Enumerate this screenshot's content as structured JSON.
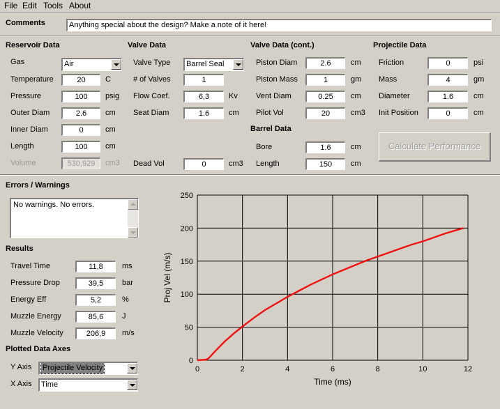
{
  "menu": [
    "File",
    "Edit",
    "Tools",
    "About"
  ],
  "comments": {
    "label": "Comments",
    "value": "Anything special about the design?  Make a note of it here!"
  },
  "reservoir": {
    "title": "Reservoir Data",
    "gas": {
      "label": "Gas",
      "value": "Air"
    },
    "temperature": {
      "label": "Temperature",
      "value": "20",
      "unit": "C"
    },
    "pressure": {
      "label": "Pressure",
      "value": "100",
      "unit": "psig"
    },
    "outer_diam": {
      "label": "Outer Diam",
      "value": "2.6",
      "unit": "cm"
    },
    "inner_diam": {
      "label": "Inner Diam",
      "value": "0",
      "unit": "cm"
    },
    "length": {
      "label": "Length",
      "value": "100",
      "unit": "cm"
    },
    "volume": {
      "label": "Volume",
      "value": "530,929",
      "unit": "cm3"
    }
  },
  "valve": {
    "title": "Valve Data",
    "type": {
      "label": "Valve Type",
      "value": "Barrel Seal"
    },
    "num_valves": {
      "label": "# of Valves",
      "value": "1"
    },
    "flow_coef": {
      "label": "Flow Coef.",
      "value": "6,3",
      "unit": "Kv"
    },
    "seat_diam": {
      "label": "Seat Diam",
      "value": "1.6",
      "unit": "cm"
    },
    "dead_vol": {
      "label": "Dead Vol",
      "value": "0",
      "unit": "cm3"
    }
  },
  "valve_cont": {
    "title": "Valve Data (cont.)",
    "piston_diam": {
      "label": "Piston Diam",
      "value": "2.6",
      "unit": "cm"
    },
    "piston_mass": {
      "label": "Piston Mass",
      "value": "1",
      "unit": "gm"
    },
    "vent_diam": {
      "label": "Vent Diam",
      "value": "0.25",
      "unit": "cm"
    },
    "pilot_vol": {
      "label": "Pilot Vol",
      "value": "20",
      "unit": "cm3"
    }
  },
  "barrel": {
    "title": "Barrel Data",
    "bore": {
      "label": "Bore",
      "value": "1.6",
      "unit": "cm"
    },
    "length": {
      "label": "Length",
      "value": "150",
      "unit": "cm"
    }
  },
  "projectile": {
    "title": "Projectile Data",
    "friction": {
      "label": "Friction",
      "value": "0",
      "unit": "psi"
    },
    "mass": {
      "label": "Mass",
      "value": "4",
      "unit": "gm"
    },
    "diameter": {
      "label": "Diameter",
      "value": "1.6",
      "unit": "cm"
    },
    "init_position": {
      "label": "Init Position",
      "value": "0",
      "unit": "cm"
    }
  },
  "calculate_label": "Calculate Performance",
  "errors": {
    "title": "Errors / Warnings",
    "text": "No warnings.  No errors."
  },
  "results": {
    "title": "Results",
    "travel_time": {
      "label": "Travel Time",
      "value": "11,8",
      "unit": "ms"
    },
    "pressure_drop": {
      "label": "Pressure Drop",
      "value": "39,5",
      "unit": "bar"
    },
    "energy_eff": {
      "label": "Energy Eff",
      "value": "5,2",
      "unit": "%"
    },
    "muzzle_energy": {
      "label": "Muzzle Energy",
      "value": "85,6",
      "unit": "J"
    },
    "muzzle_velocity": {
      "label": "Muzzle Velocity",
      "value": "206,9",
      "unit": "m/s"
    }
  },
  "axes": {
    "title": "Plotted Data Axes",
    "y": {
      "label": "Y Axis",
      "value": "Projectile Velocity"
    },
    "x": {
      "label": "X Axis",
      "value": "Time"
    }
  },
  "colors": {
    "curve": "#ee1111",
    "background": "#d4d0c8"
  },
  "chart_data": {
    "type": "line",
    "xlabel": "Time (ms)",
    "ylabel": "Proj Vel (m/s)",
    "xlim": [
      0,
      12
    ],
    "ylim": [
      0,
      250
    ],
    "xticks": [
      0,
      2,
      4,
      6,
      8,
      10,
      12
    ],
    "yticks": [
      0,
      50,
      100,
      150,
      200,
      250
    ],
    "grid": true,
    "series": [
      {
        "x": [
          0,
          0.4,
          0.5,
          0.8,
          1.2,
          1.6,
          2.0,
          2.5,
          3.0,
          3.5,
          4.0,
          4.5,
          5.0,
          5.5,
          6.0,
          6.5,
          7.0,
          7.5,
          8.0,
          8.5,
          9.0,
          9.5,
          10.0,
          10.5,
          11.0,
          11.5,
          11.8
        ],
        "y": [
          0,
          1,
          3,
          14,
          28,
          40,
          51,
          64,
          76,
          86,
          96,
          105,
          114,
          122,
          130,
          137,
          144,
          151,
          157,
          163,
          169,
          175,
          180,
          186,
          192,
          197,
          200
        ]
      }
    ]
  }
}
